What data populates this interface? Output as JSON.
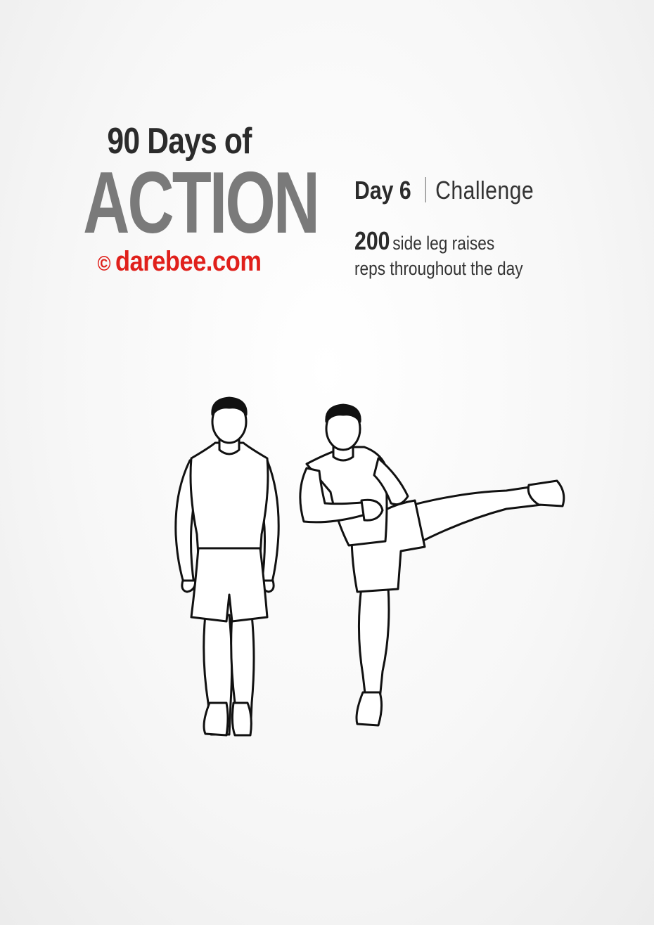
{
  "header": {
    "title_top": "90 Days of",
    "title_main": "ACTION",
    "copyright_symbol": "©",
    "brand": "darebee.com"
  },
  "challenge": {
    "day": "Day 6",
    "type": "Challenge",
    "count": "200",
    "exercise": "side leg raises",
    "note": "reps throughout the day"
  },
  "colors": {
    "title_dark": "#2b2b2b",
    "title_gray": "#7a7a7a",
    "brand_red": "#e0201b",
    "background": "#f4f4f4"
  },
  "illustration": {
    "figures": [
      "standing-figure",
      "side-leg-raise-figure"
    ]
  }
}
